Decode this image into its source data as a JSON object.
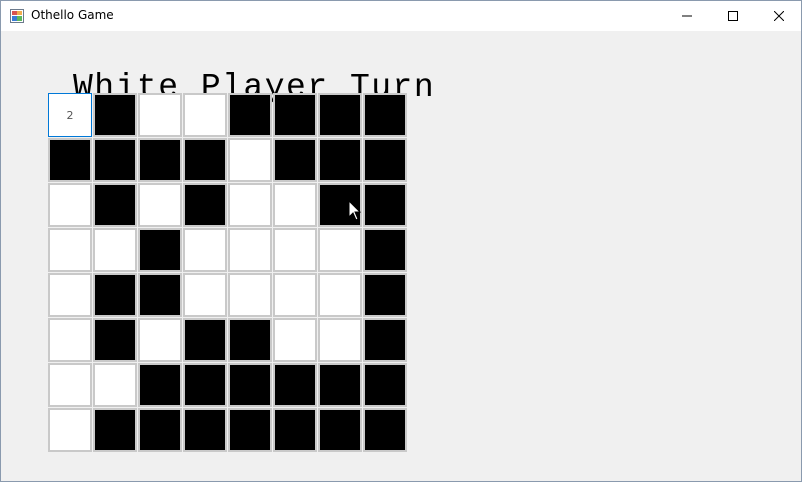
{
  "window": {
    "title": "Othello Game",
    "controls": {
      "minimize": "minimize-icon",
      "maximize": "maximize-icon",
      "close": "close-icon"
    }
  },
  "turn_label": "White Player Turn",
  "colors": {
    "black_piece": "#000000",
    "white_piece": "#ffffff",
    "cell_border": "#c9c9c9",
    "focus_border": "#0078d7"
  },
  "board": {
    "focused_cell_text": "2",
    "rows": [
      [
        "focused",
        "black",
        "white",
        "white",
        "black",
        "black",
        "black",
        "black"
      ],
      [
        "black",
        "black",
        "black",
        "black",
        "white",
        "black",
        "black",
        "black"
      ],
      [
        "white",
        "black",
        "white",
        "black",
        "white",
        "white",
        "black",
        "black"
      ],
      [
        "white",
        "white",
        "black",
        "white",
        "white",
        "white",
        "white",
        "black"
      ],
      [
        "white",
        "black",
        "black",
        "white",
        "white",
        "white",
        "white",
        "black"
      ],
      [
        "white",
        "black",
        "white",
        "black",
        "black",
        "white",
        "white",
        "black"
      ],
      [
        "white",
        "white",
        "black",
        "black",
        "black",
        "black",
        "black",
        "black"
      ],
      [
        "white",
        "black",
        "black",
        "black",
        "black",
        "black",
        "black",
        "black"
      ]
    ]
  }
}
